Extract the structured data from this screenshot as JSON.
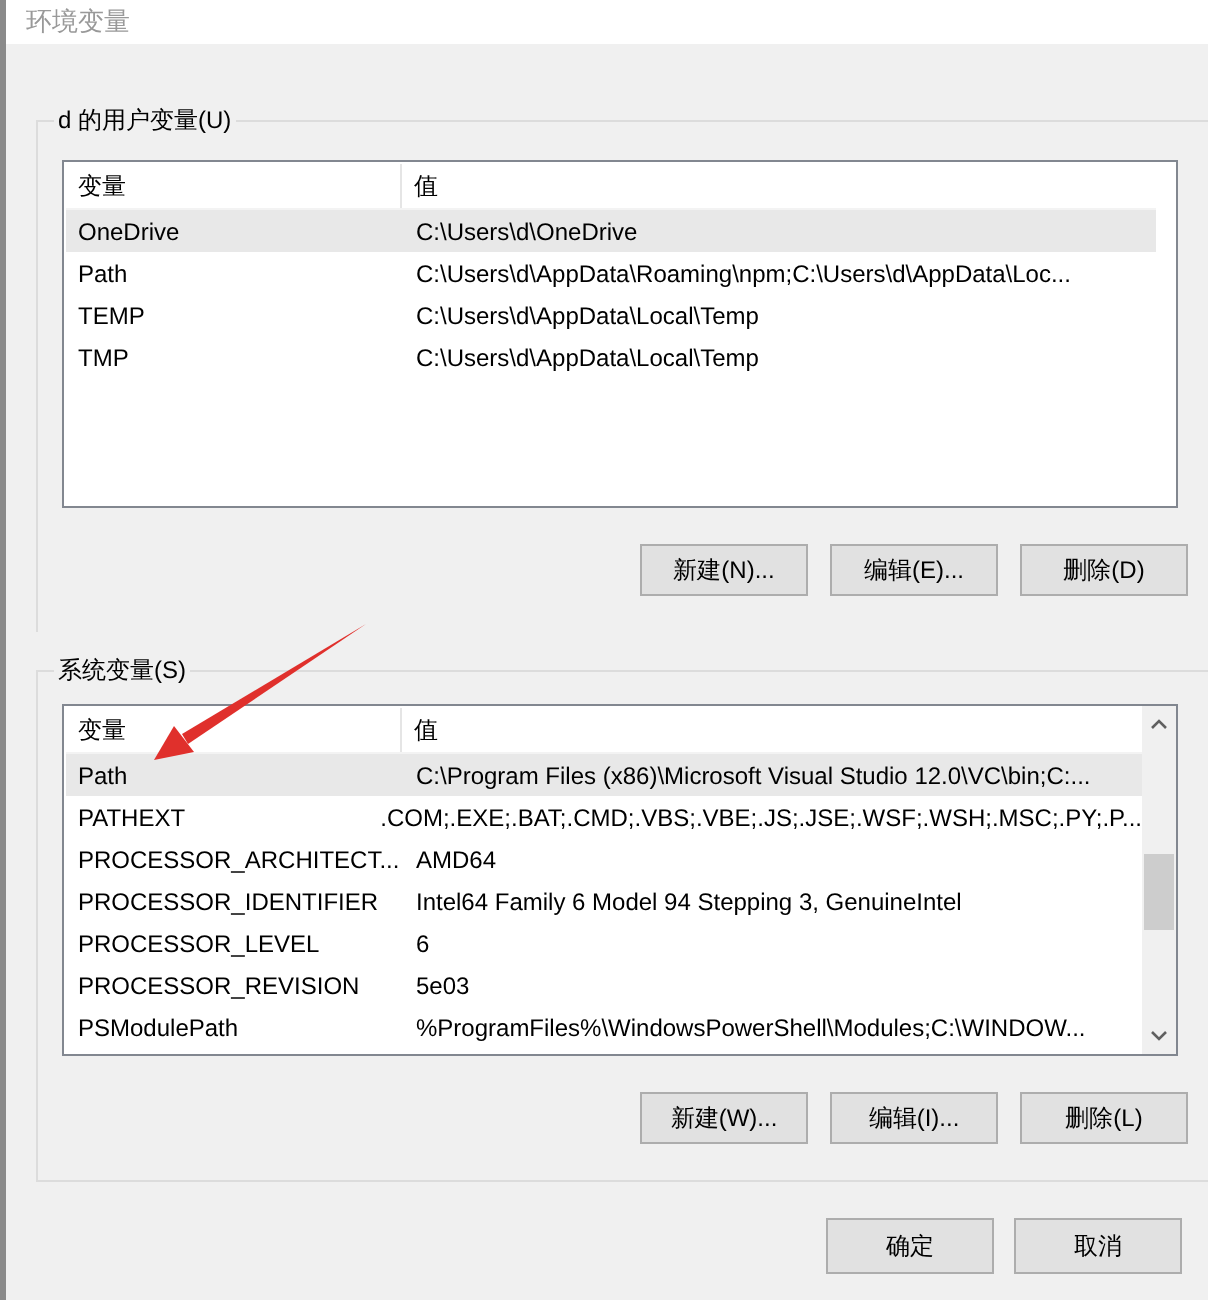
{
  "window": {
    "title": "环境变量"
  },
  "user_variables": {
    "title": "d 的用户变量(U)",
    "columns": [
      "变量",
      "值"
    ],
    "rows": [
      {
        "name": "OneDrive",
        "value": "C:\\Users\\d\\OneDrive",
        "selected": true
      },
      {
        "name": "Path",
        "value": "C:\\Users\\d\\AppData\\Roaming\\npm;C:\\Users\\d\\AppData\\Loc...",
        "selected": false
      },
      {
        "name": "TEMP",
        "value": "C:\\Users\\d\\AppData\\Local\\Temp",
        "selected": false
      },
      {
        "name": "TMP",
        "value": "C:\\Users\\d\\AppData\\Local\\Temp",
        "selected": false
      }
    ],
    "buttons": [
      "新建(N)...",
      "编辑(E)...",
      "删除(D)"
    ]
  },
  "system_variables": {
    "title": "系统变量(S)",
    "columns": [
      "变量",
      "值"
    ],
    "rows": [
      {
        "name": "Path",
        "value": "C:\\Program Files (x86)\\Microsoft Visual Studio 12.0\\VC\\bin;C:...",
        "selected": true
      },
      {
        "name": "PATHEXT",
        "value": ".COM;.EXE;.BAT;.CMD;.VBS;.VBE;.JS;.JSE;.WSF;.WSH;.MSC;.PY;.P...",
        "selected": false
      },
      {
        "name": "PROCESSOR_ARCHITECT...",
        "value": "AMD64",
        "selected": false
      },
      {
        "name": "PROCESSOR_IDENTIFIER",
        "value": "Intel64 Family 6 Model 94 Stepping 3, GenuineIntel",
        "selected": false
      },
      {
        "name": "PROCESSOR_LEVEL",
        "value": "6",
        "selected": false
      },
      {
        "name": "PROCESSOR_REVISION",
        "value": "5e03",
        "selected": false
      },
      {
        "name": "PSModulePath",
        "value": "%ProgramFiles%\\WindowsPowerShell\\Modules;C:\\WINDOW...",
        "selected": false
      }
    ],
    "buttons": [
      "新建(W)...",
      "编辑(I)...",
      "删除(L)"
    ]
  },
  "dialog_buttons": [
    "确定",
    "取消"
  ]
}
